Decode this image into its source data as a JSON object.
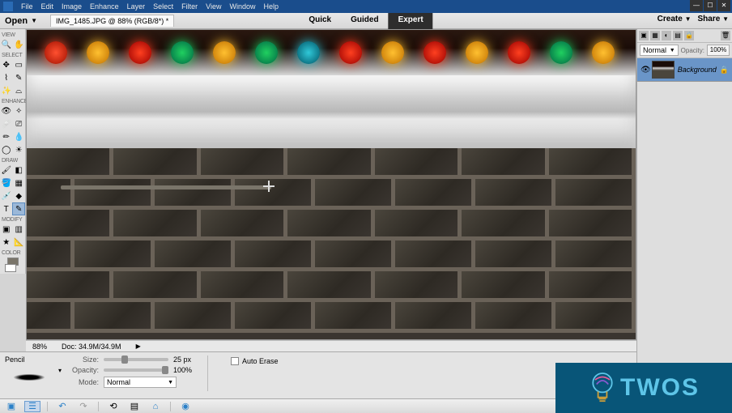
{
  "menu": {
    "items": [
      "File",
      "Edit",
      "Image",
      "Enhance",
      "Layer",
      "Select",
      "Filter",
      "View",
      "Window",
      "Help"
    ]
  },
  "openbar": {
    "open_label": "Open",
    "doc_tab": "IMG_1485.JPG @ 88% (RGB/8*) *"
  },
  "mode_tabs": {
    "quick": "Quick",
    "guided": "Guided",
    "expert": "Expert"
  },
  "right_actions": {
    "create": "Create",
    "share": "Share"
  },
  "toolbox": {
    "sections": {
      "view": "VIEW",
      "select": "SELECT",
      "enhance": "ENHANCE",
      "draw": "DRAW",
      "modify": "MODIFY",
      "color": "COLOR"
    }
  },
  "status": {
    "zoom": "88%",
    "doc_info": "Doc: 34.9M/34.9M"
  },
  "options": {
    "tool_name": "Pencil",
    "size_label": "Size:",
    "size_value": "25 px",
    "opacity_label": "Opacity:",
    "opacity_value": "100%",
    "mode_label": "Mode:",
    "mode_value": "Normal",
    "auto_erase": "Auto Erase"
  },
  "layers": {
    "blend_mode": "Normal",
    "opacity_label": "Opacity:",
    "opacity_value": "100%",
    "layer_name": "Background"
  },
  "watermark": {
    "text": "TWOS"
  },
  "colors": {
    "menubar": "#1a4d8c",
    "expert_tab": "#2d2d2d",
    "layer_selected": "#6a95c8",
    "watermark_bg": "#085578",
    "watermark_text": "#5ec5e8"
  }
}
